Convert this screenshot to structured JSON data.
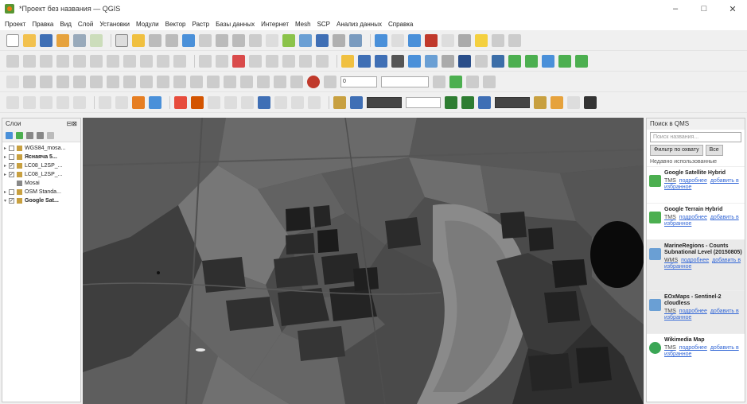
{
  "window": {
    "title": "*Проект без названия — QGIS",
    "minimize_label": "–",
    "maximize_label": "□",
    "close_label": "✕"
  },
  "menu": [
    "Проект",
    "Правка",
    "Вид",
    "Слой",
    "Установки",
    "Модули",
    "Вектор",
    "Растр",
    "Базы данных",
    "Интернет",
    "Mesh",
    "SCP",
    "Анализ данных",
    "Справка"
  ],
  "toolbar_inputs": {
    "row4_input1": "0",
    "row4_input2": "",
    "row5_input1": "",
    "row5_input2": "",
    "row5_input3": ""
  },
  "layers_panel": {
    "title": "Слои",
    "controls": "⊟⊠",
    "items": [
      {
        "name": "WGS84_mosa...",
        "checked": false,
        "bold": false
      },
      {
        "name": "Яснаяча 5...",
        "checked": false,
        "bold": true
      },
      {
        "name": "LC08_L2SP_...",
        "checked": true,
        "bold": false
      },
      {
        "name": "LC08_L2SP_...",
        "checked": true,
        "bold": false
      },
      {
        "name": "Mosai",
        "checked": false,
        "bold": false
      },
      {
        "name": "OSM Standa...",
        "checked": false,
        "bold": false
      },
      {
        "name": "Google Sat...",
        "checked": true,
        "bold": true
      }
    ]
  },
  "qms_panel": {
    "title": "Поиск в QMS",
    "search_placeholder": "Поиск названия...",
    "filter_button": "Фильтр по охвату",
    "all_button": "Все",
    "section_label": "Недавно использованные",
    "results": [
      {
        "title": "Google Satellite Hybrid",
        "type": "TMS",
        "link1": "подробнее",
        "link2": "добавить в избранное"
      },
      {
        "title": "Google Terrain Hybrid",
        "type": "TMS",
        "link1": "подробнее",
        "link2": "добавить в избранное"
      },
      {
        "title": "MarineRegions - Counts Subnational Level (20150805)",
        "type": "WMS",
        "link1": "подробнее",
        "link2": "добавить в избранное"
      },
      {
        "title": "EOxMaps - Sentinel-2 cloudless",
        "type": "TMS",
        "link1": "подробнее",
        "link2": "добавить в избранное"
      },
      {
        "title": "Wikimedia Map",
        "type": "TMS",
        "link1": "подробнее",
        "link2": "добавить в избранное"
      }
    ]
  },
  "colors": {
    "qgis_green": "#589632",
    "qgis_orange": "#ee7913",
    "link_blue": "#3367d6"
  }
}
